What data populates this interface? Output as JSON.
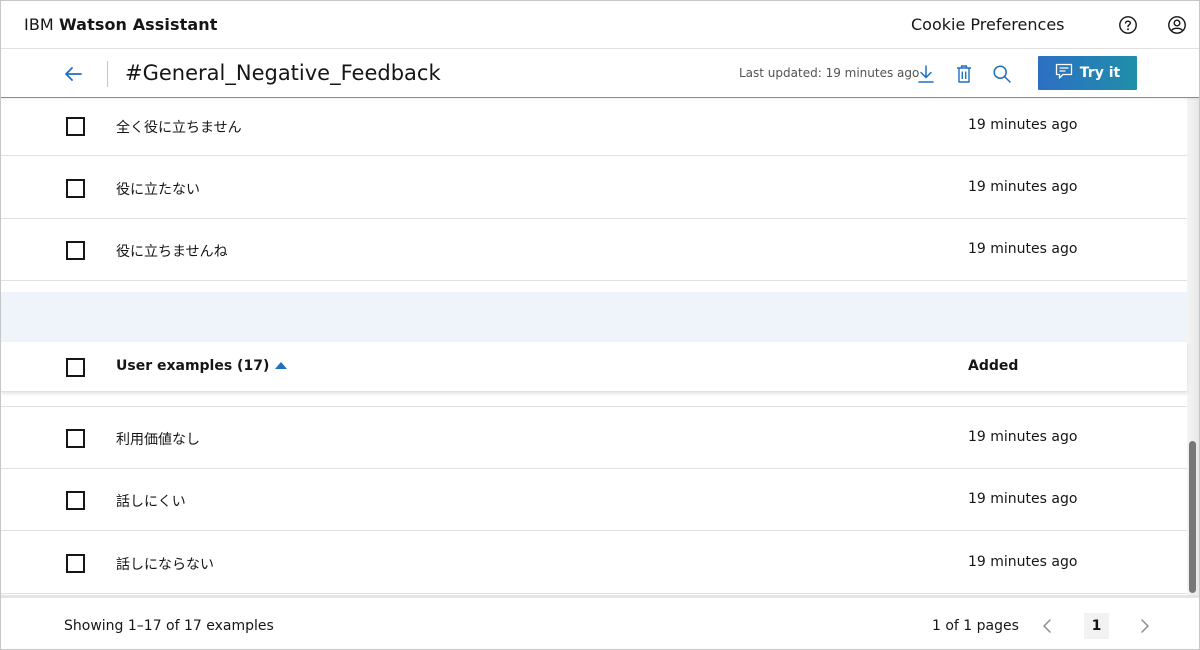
{
  "app": {
    "brand_prefix": "IBM",
    "brand_name": "Watson Assistant",
    "cookie_preferences": "Cookie Preferences",
    "help_icon": "help-circle-icon",
    "user_icon": "user-avatar-icon"
  },
  "intent_header": {
    "back_icon": "arrow-left-icon",
    "title": "#General_Negative_Feedback",
    "last_updated": "Last updated: 19 minutes ago",
    "download_icon": "download-icon",
    "delete_icon": "trash-icon",
    "search_icon": "search-icon",
    "try_it_label": "Try it",
    "try_it_icon": "chat-icon",
    "try_it_colors": [
      "#2d6fc4",
      "#1f8fa8"
    ]
  },
  "top_rows": [
    {
      "text": "全く役に立ちません",
      "added": "19 minutes ago"
    },
    {
      "text": "役に立たない",
      "added": "19 minutes ago"
    },
    {
      "text": "役に立ちませんね",
      "added": "19 minutes ago"
    }
  ],
  "table_header": {
    "examples_label": "User examples (17)",
    "sort": "ascending",
    "added_label": "Added"
  },
  "bottom_rows": [
    {
      "text": "利用価値なし",
      "added": "19 minutes ago"
    },
    {
      "text": "話しにくい",
      "added": "19 minutes ago"
    },
    {
      "text": "話しにならない",
      "added": "19 minutes ago"
    }
  ],
  "footer": {
    "showing": "Showing 1–17 of 17 examples",
    "pages": "1 of 1 pages",
    "current_page": "1",
    "prev_icon": "chevron-left-icon",
    "next_icon": "chevron-right-icon"
  },
  "colors": {
    "accent": "#1f70c1",
    "band": "#eff3fa"
  }
}
